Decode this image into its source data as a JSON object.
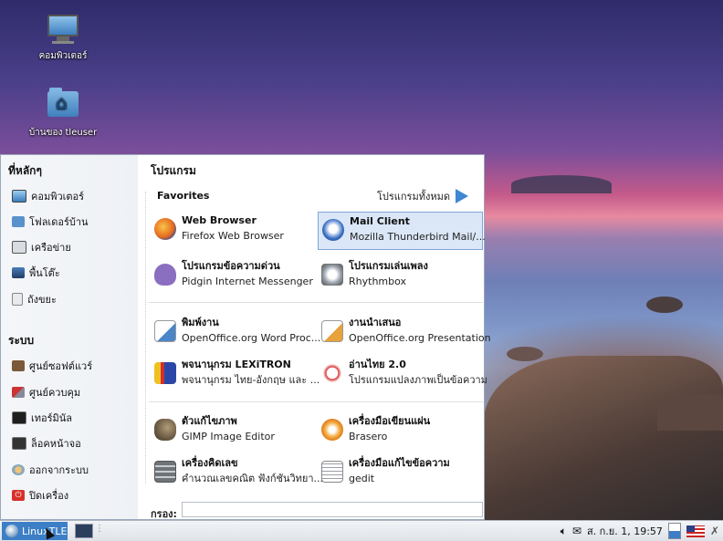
{
  "desktop": {
    "icons": [
      {
        "label": "คอมพิวเตอร์",
        "icon": "computer-icon"
      },
      {
        "label": "บ้านของ tleuser",
        "icon": "home-folder-icon"
      }
    ]
  },
  "menu": {
    "places_title": "ที่หลักๆ",
    "places": [
      {
        "label": "คอมพิวเตอร์",
        "icon": "computer-icon"
      },
      {
        "label": "โฟลเดอร์บ้าน",
        "icon": "home-folder-icon"
      },
      {
        "label": "เครือข่าย",
        "icon": "network-icon"
      },
      {
        "label": "พื้นโต๊ะ",
        "icon": "desktop-icon"
      },
      {
        "label": "ถังขยะ",
        "icon": "trash-icon"
      }
    ],
    "system_title": "ระบบ",
    "system": [
      {
        "label": "ศูนย์ซอฟต์แวร์",
        "icon": "software-center-icon"
      },
      {
        "label": "ศูนย์ควบคุม",
        "icon": "control-center-icon"
      },
      {
        "label": "เทอร์มินัล",
        "icon": "terminal-icon"
      },
      {
        "label": "ล็อคหน้าจอ",
        "icon": "lock-screen-icon"
      },
      {
        "label": "ออกจากระบบ",
        "icon": "logout-icon"
      },
      {
        "label": "ปิดเครื่อง",
        "icon": "power-icon"
      }
    ],
    "programs_title": "โปรแกรม",
    "favorites_title": "Favorites",
    "all_programs": "โปรแกรมทั้งหมด",
    "apps": [
      {
        "name": "Web Browser",
        "desc": "Firefox Web Browser",
        "icon": "firefox-icon",
        "color": "#e66a1f"
      },
      {
        "name": "Mail Client",
        "desc": "Mozilla Thunderbird Mail/...",
        "icon": "thunderbird-icon",
        "color": "#3a6fc4"
      },
      {
        "name": "โปรแกรมข้อความด่วน",
        "desc": "Pidgin Internet Messenger",
        "icon": "pidgin-icon",
        "color": "#7b5fb3"
      },
      {
        "name": "โปรแกรมเล่นเพลง",
        "desc": "Rhythmbox",
        "icon": "rhythmbox-icon",
        "color": "#9aa3ad"
      },
      {
        "name": "พิมพ์งาน",
        "desc": "OpenOffice.org Word Proc...",
        "icon": "writer-icon",
        "color": "#4a86c8"
      },
      {
        "name": "งานนำเสนอ",
        "desc": "OpenOffice.org Presentation",
        "icon": "impress-icon",
        "color": "#e8a23a"
      },
      {
        "name": "พจนานุกรม LEXiTRON",
        "desc": "พจนานุกรม ไทย-อังกฤษ และ ...",
        "icon": "lexitron-icon",
        "color": "#2a47a8"
      },
      {
        "name": "อ่านไทย 2.0",
        "desc": "โปรแกรมแปลงภาพเป็นข้อความ",
        "icon": "arnthai-icon",
        "color": "#d93a3a"
      },
      {
        "name": "ตัวแก้ไขภาพ",
        "desc": "GIMP Image Editor",
        "icon": "gimp-icon",
        "color": "#6b5a43"
      },
      {
        "name": "เครื่องมือเขียนแผ่น",
        "desc": "Brasero",
        "icon": "brasero-icon",
        "color": "#e07b1a"
      },
      {
        "name": "เครื่องคิดเลข",
        "desc": "คำนวณเลขคณิต ฟังก์ชันวิทยา...",
        "icon": "calculator-icon",
        "color": "#6f7478"
      },
      {
        "name": "เครื่องมือแก้ไขข้อความ",
        "desc": "gedit",
        "icon": "gedit-icon",
        "color": "#8a9099"
      }
    ],
    "search_label": "กรอง:",
    "search_value": ""
  },
  "taskbar": {
    "start_label": "LinuxTLE",
    "clock": "ส. ก.ย.  1, 19:57"
  }
}
